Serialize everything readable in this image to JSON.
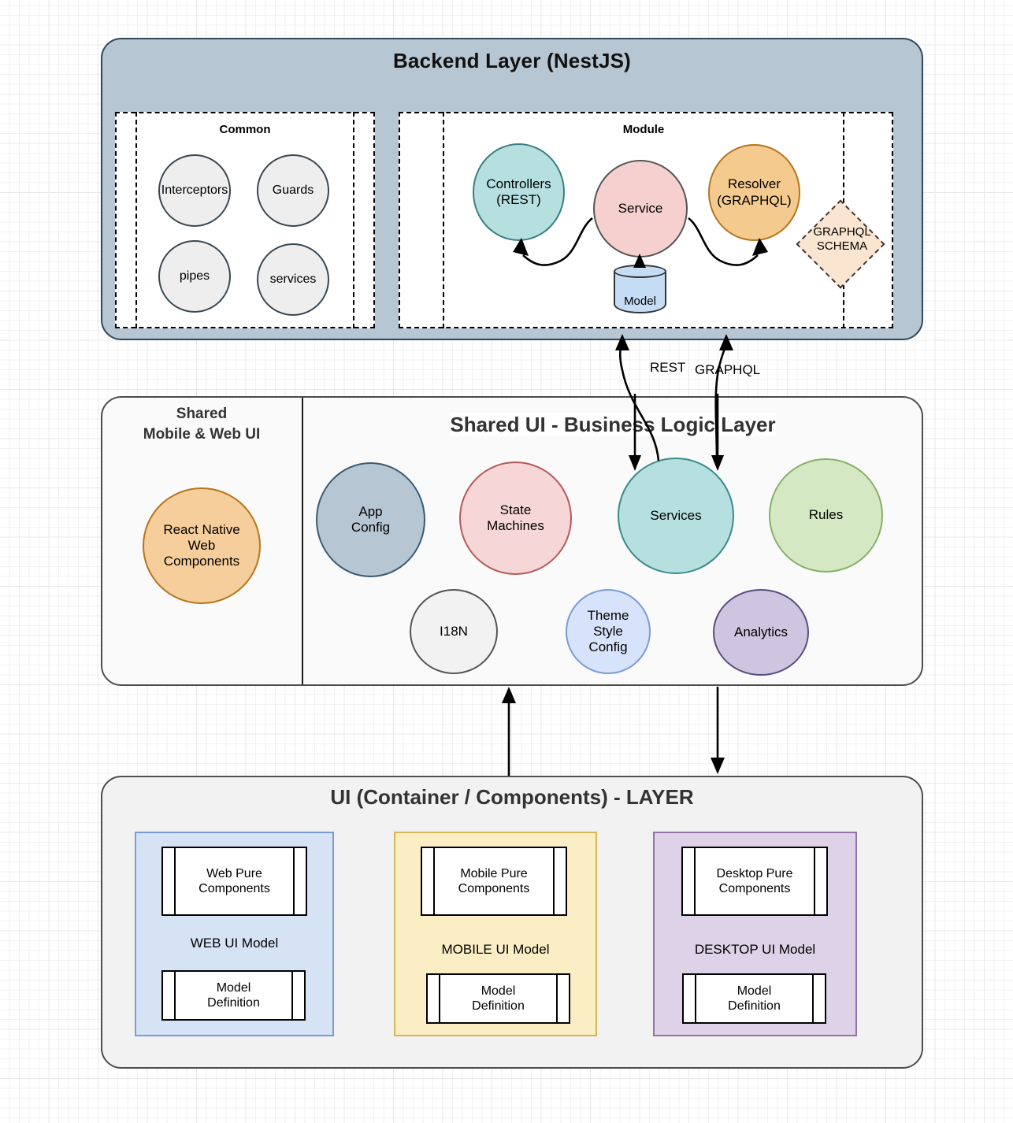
{
  "backend": {
    "title": "Backend Layer (NestJS)",
    "common": {
      "title": "Common",
      "nodes": [
        {
          "label": "Interceptors"
        },
        {
          "label": "Guards"
        },
        {
          "label": "pipes"
        },
        {
          "label": "services"
        }
      ]
    },
    "module": {
      "title": "Module",
      "controllers": "Controllers\n(REST)",
      "controllers_line1": "Controllers",
      "controllers_line2": "(REST)",
      "service": "Service",
      "resolver_line1": "Resolver",
      "resolver_line2": "(GRAPHQL)",
      "model": "Model",
      "schema_line1": "GRAPHQL",
      "schema_line2": "SCHEMA"
    }
  },
  "connectors": {
    "rest": "REST",
    "graphql": "GRAPHQL"
  },
  "shared_ui": {
    "left_title_line1": "Shared",
    "left_title_line2": "Mobile & Web UI",
    "main_title": "Shared UI - Business Logic Layer",
    "left_node": {
      "line1": "React Native",
      "line2": "Web",
      "line3": "Components"
    },
    "nodes": [
      {
        "line1": "App",
        "line2": "Config"
      },
      {
        "line1": "State",
        "line2": "Machines"
      },
      {
        "line1": "Services",
        "line2": ""
      },
      {
        "line1": "Rules",
        "line2": ""
      },
      {
        "line1": "I18N",
        "line2": ""
      },
      {
        "line1": "Theme",
        "line2": "Style",
        "line3": "Config"
      },
      {
        "line1": "Analytics",
        "line2": ""
      }
    ]
  },
  "ui_layer": {
    "title": "UI (Container / Components) - LAYER",
    "panels": [
      {
        "component_line1": "Web Pure",
        "component_line2": "Components",
        "model_label": "WEB UI Model",
        "model_line1": "Model",
        "model_line2": "Definition"
      },
      {
        "component_line1": "Mobile Pure",
        "component_line2": "Components",
        "model_label": "MOBILE UI Model",
        "model_line1": "Model",
        "model_line2": "Definition"
      },
      {
        "component_line1": "Desktop Pure",
        "component_line2": "Components",
        "model_label": "DESKTOP UI Model",
        "model_line1": "Model",
        "model_line2": "Definition"
      }
    ]
  },
  "colors": {
    "backend_fill": "#b7c6d3",
    "backend_stroke": "#2f4858",
    "teal": "#b6dfdf",
    "pink": "#f6cfcf",
    "orange": "#f4ca8e",
    "peach": "#fae5d0",
    "model_blue": "#c5dcf5",
    "green": "#d5e8c4",
    "purple": "#cec6e0",
    "lavender": "#d6e3fa",
    "panel_web": "#d6e3f5",
    "panel_mobile": "#fbeec5",
    "panel_desktop": "#ddd2e8"
  }
}
